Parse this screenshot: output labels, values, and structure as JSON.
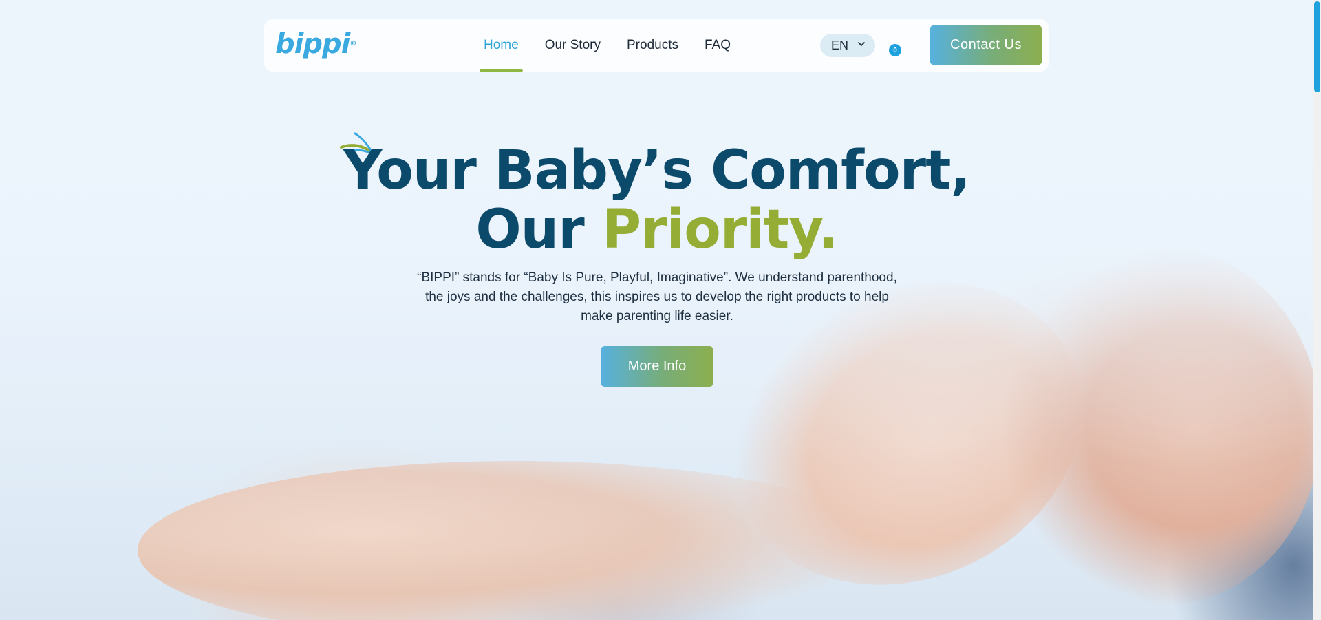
{
  "brand": {
    "logo_text": "bippi",
    "logo_mark": "®"
  },
  "nav": {
    "items": [
      {
        "label": "Home",
        "active": true
      },
      {
        "label": "Our Story",
        "active": false
      },
      {
        "label": "Products",
        "active": false
      },
      {
        "label": "FAQ",
        "active": false
      }
    ]
  },
  "language": {
    "selected": "EN"
  },
  "cart": {
    "count": "0"
  },
  "header": {
    "contact_label": "Contact Us"
  },
  "hero": {
    "headline_line1": "Your Baby’s Comfort,",
    "headline_line2_prefix": "Our ",
    "headline_line2_accent": "Priority.",
    "description": "“BIPPI” stands for “Baby Is Pure, Playful, Imaginative”. We understand parenthood, the joys and the challenges, this inspires us to develop the right products to help make parenting life easier.",
    "cta_label": "More Info"
  },
  "colors": {
    "primary_blue": "#1ea1dc",
    "dark_navy": "#0c4a6b",
    "accent_green": "#95ad35",
    "active_underline": "#8fb843"
  }
}
